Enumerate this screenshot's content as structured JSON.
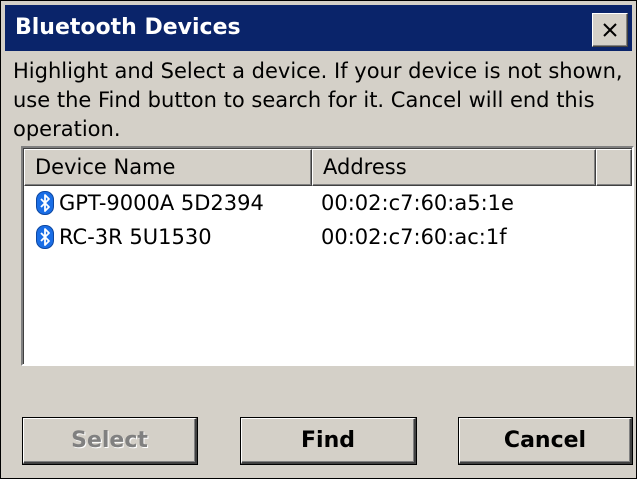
{
  "window": {
    "title": "Bluetooth Devices"
  },
  "instructions": "Highlight and Select a device.  If your device is not shown, use the Find button to search for it. Cancel will end this operation.",
  "list": {
    "columns": [
      "Device Name",
      "Address",
      ""
    ],
    "rows": [
      {
        "icon": "bluetooth-icon",
        "name": "GPT-9000A 5D2394",
        "address": "00:02:c7:60:a5:1e"
      },
      {
        "icon": "bluetooth-icon",
        "name": "RC-3R 5U1530",
        "address": "00:02:c7:60:ac:1f"
      }
    ]
  },
  "buttons": {
    "select": "Select",
    "find": "Find",
    "cancel": "Cancel"
  },
  "colors": {
    "titlebar": "#0a246a",
    "bluetooth": "#1a6ee6"
  }
}
